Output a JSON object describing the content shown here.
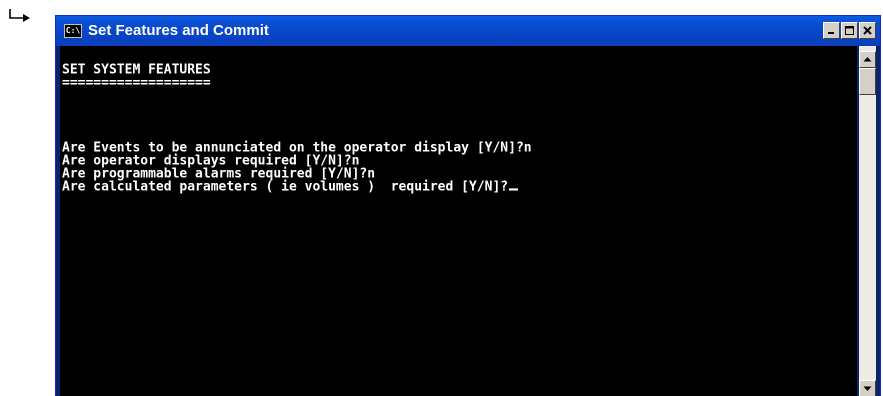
{
  "window": {
    "title": "Set Features and Commit",
    "icon_text": "C:\\",
    "buttons": [
      "minimize",
      "maximize",
      "close"
    ]
  },
  "console": {
    "lines": [
      "SET SYSTEM FEATURES",
      "===================",
      "",
      "",
      "Are Events to be annunciated on the operator display [Y/N]?n",
      "Are operator displays required [Y/N]?n",
      "Are programmable alarms required [Y/N]?n",
      "Are calculated parameters ( ie volumes )  required [Y/N]?"
    ],
    "cursor": "_"
  },
  "icons": {
    "corner": "return-arrow-icon",
    "console_app": "console-app-icon",
    "minimize": "minimize-icon",
    "maximize": "maximize-icon",
    "close": "close-icon",
    "scroll_up": "scroll-up-arrow-icon",
    "scroll_down": "scroll-down-arrow-icon"
  },
  "colors": {
    "titlebar": "#0845c6",
    "console_bg": "#000000",
    "console_text": "#ffffff"
  }
}
